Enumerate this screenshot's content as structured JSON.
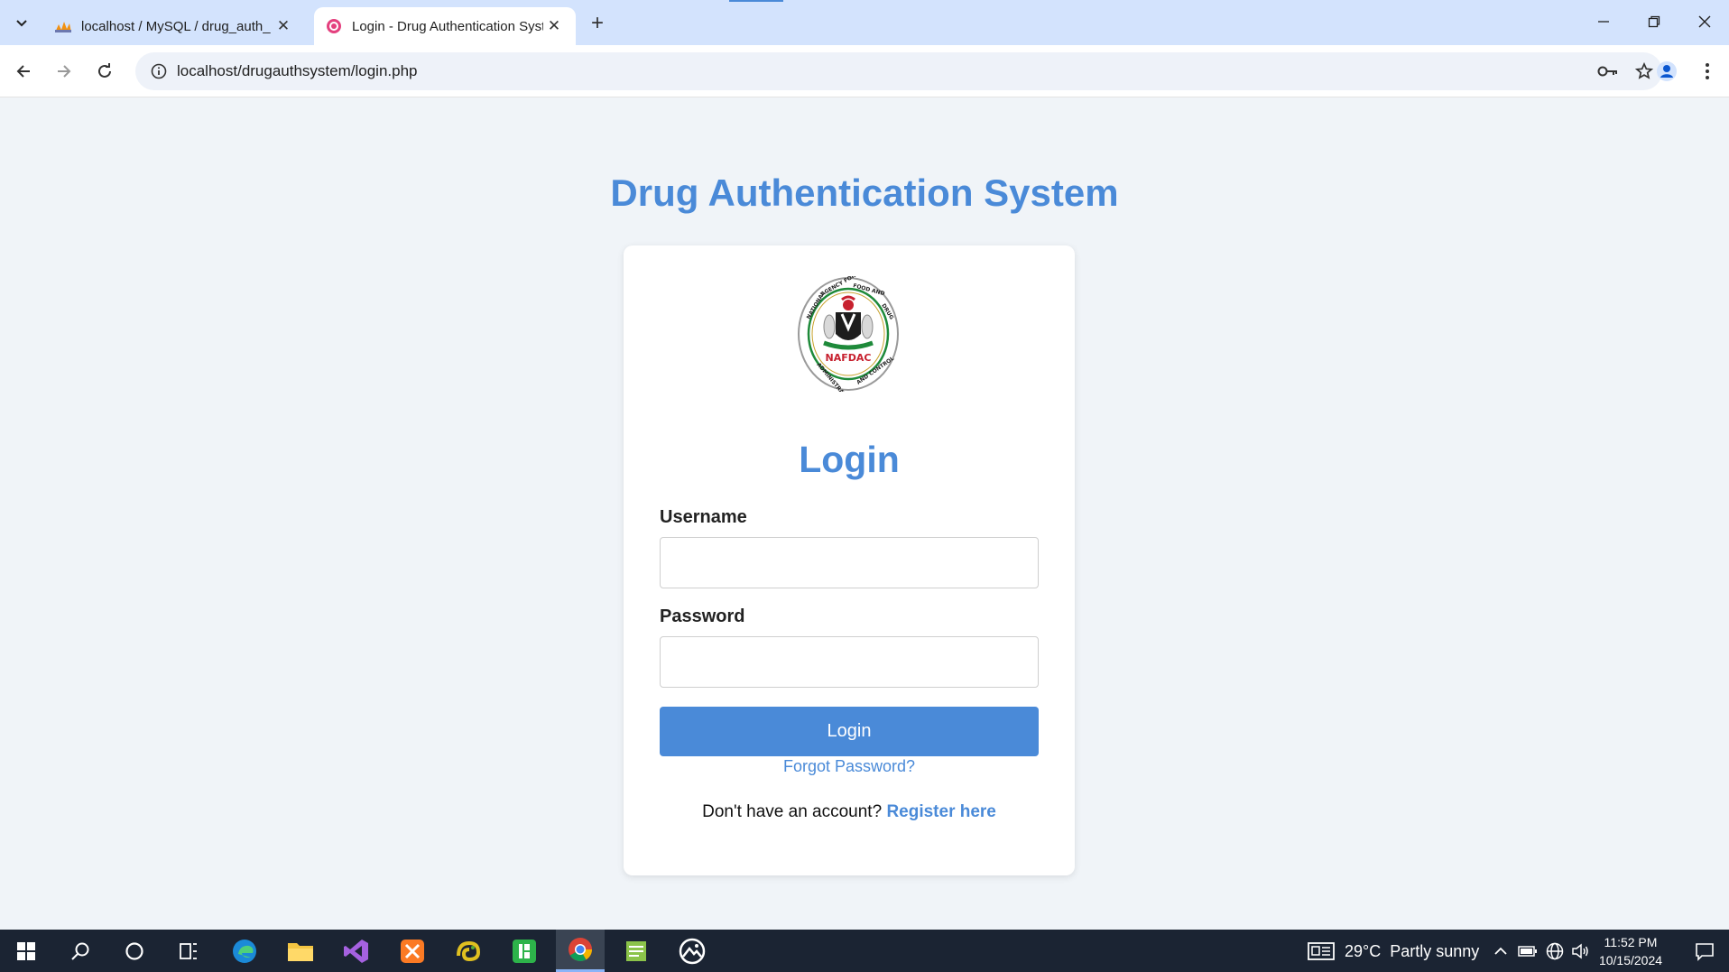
{
  "browser": {
    "tabs": [
      {
        "title": "localhost / MySQL / drug_auth_",
        "favicon": "phpmyadmin-icon",
        "active": false
      },
      {
        "title": "Login - Drug Authentication System",
        "favicon": "webpage-icon",
        "active": true
      }
    ],
    "address": "localhost/drugauthsystem/login.php"
  },
  "page": {
    "heading": "Drug Authentication System",
    "logo": {
      "name": "nafdac-logo",
      "ring_text": "NATIONAL AGENCY FOR FOOD AND DRUG ADMINISTRATION AND CONTROL",
      "center_text": "NAFDAC"
    },
    "form": {
      "title": "Login",
      "username_label": "Username",
      "username_value": "",
      "password_label": "Password",
      "password_value": "",
      "submit_label": "Login",
      "forgot_link": "Forgot Password?",
      "register_prompt": "Don't have an account?",
      "register_link": "Register here"
    }
  },
  "taskbar": {
    "weather": "29°C  Partly sunny",
    "time": "11:52 PM",
    "date": "10/15/2024"
  },
  "colors": {
    "accent": "#4a8ad8",
    "page_bg": "#f0f4f8",
    "tabstrip_bg": "#d3e3fd",
    "taskbar_bg": "#1b2433"
  }
}
